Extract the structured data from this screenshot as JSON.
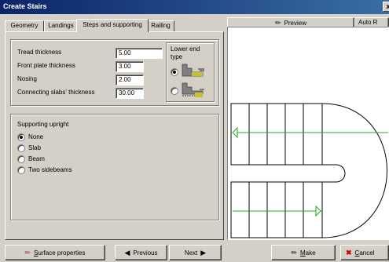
{
  "window": {
    "title": "Create Stairs",
    "close_label": "x"
  },
  "tabs": [
    "Geometry",
    "Landings",
    "Steps and supporting",
    "Railing"
  ],
  "active_tab": "Steps and supporting",
  "fields": {
    "tread_thickness": {
      "label": "Tread thickness",
      "value": "5.00"
    },
    "front_plate_thickness": {
      "label": "Front plate thickness",
      "value": "3.00"
    },
    "nosing": {
      "label": "Nosing",
      "value": "2.00"
    },
    "connecting_slabs_thickness": {
      "label": "Connecting slabs' thickness",
      "value": "30.00"
    }
  },
  "lower_end_type": {
    "label": "Lower end type",
    "selected": 0
  },
  "supporting_upright": {
    "label": "Supporting upright",
    "options": [
      "None",
      "Slab",
      "Beam",
      "Two sidebeams"
    ],
    "selected": "None"
  },
  "preview": {
    "label": "Preview",
    "auto_label": "Auto R"
  },
  "buttons": {
    "surface_properties": {
      "underline": "S",
      "rest": "urface properties"
    },
    "previous": "Previous",
    "next": "Next",
    "make": {
      "underline": "M",
      "rest": "ake"
    },
    "cancel": {
      "underline": "C",
      "rest": "ancel"
    }
  },
  "colors": {
    "titlebar_start": "#0a246a",
    "titlebar_end": "#3a6ea5",
    "stair_arrow": "#22aa22",
    "face": "#d4d0c8"
  }
}
